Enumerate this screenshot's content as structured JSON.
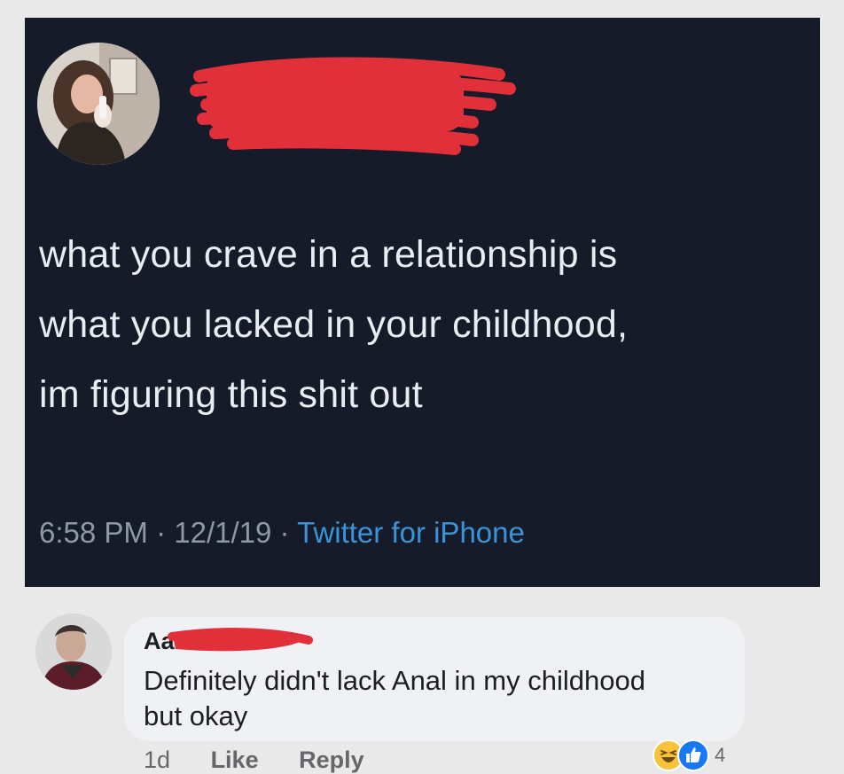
{
  "tweet": {
    "text": "what you crave in a relationship is\nwhat you lacked in your childhood,\nim figuring this shit out",
    "time": "6:58 PM",
    "date": "12/1/19",
    "source": "Twitter for iPhone",
    "separator": " · ",
    "colors": {
      "background": "#151b28",
      "text": "#e9edf2",
      "meta": "#8c99a6",
      "link": "#3b93d8",
      "redaction": "#e2303a"
    }
  },
  "comment": {
    "author_visible": "Aa",
    "text": "Definitely didn't lack Anal in my childhood\nbut okay",
    "age": "1d",
    "like_label": "Like",
    "reply_label": "Reply",
    "reactions": {
      "icons": [
        "haha-icon",
        "like-icon"
      ],
      "count": "4"
    },
    "colors": {
      "bubble": "#f0f1f4",
      "text": "#1c1e21",
      "meta": "#65676b",
      "like_blue": "#1877f2",
      "haha_yellow": "#f7c33d"
    }
  }
}
